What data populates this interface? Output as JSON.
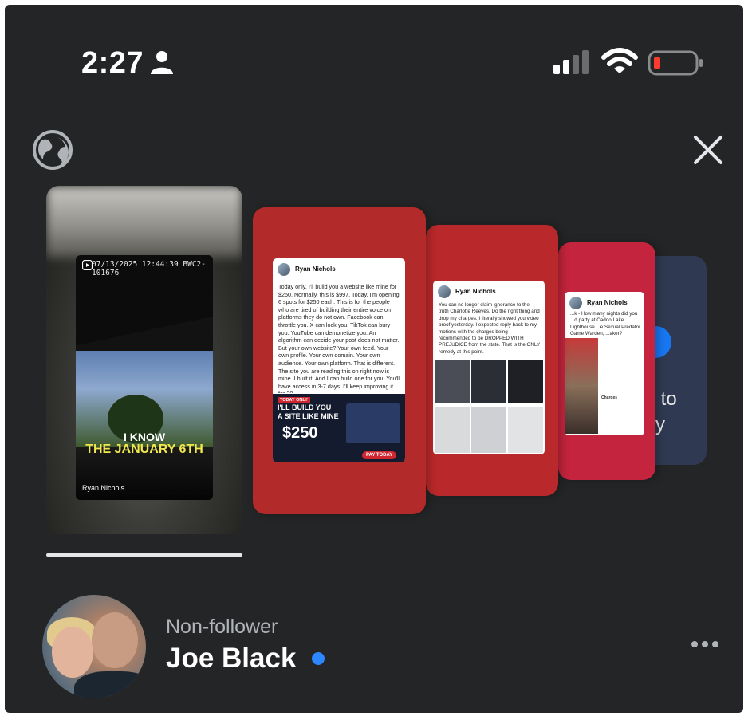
{
  "status_bar": {
    "time": "2:27"
  },
  "cards": [
    {
      "reel": {
        "timestamp": "07/13/2025 12:44:39  BWC2-101676",
        "caption_line1": "I KNOW",
        "caption_line2": "THE JANUARY 6TH",
        "author": "Ryan Nichols"
      }
    },
    {
      "author": "Ryan Nichols",
      "text": "Today only. I'll build you a website like mine for $250. Normally, this is $997. Today, I'm opening 6 spots for $250 each. This is for the people who are tired of building their entire voice on platforms they do not own. Facebook can throttle you. X can lock you. TikTok can bury you. YouTube can demonetize you. An algorithm can decide your post does not matter. But your own website? Your own feed. Your own profile. Your own domain. Your own audience. Your own platform. That is different. The site you are reading this on right now is mine. I built it. And I can build one for you. You'll have access in 3-7 days. I'll keep improving it for 30...",
      "ad": {
        "badge": "TODAY ONLY",
        "line1": "I'LL BUILD YOU",
        "line2": "A SITE LIKE MINE",
        "price": "$250",
        "cta": "PAY TODAY"
      }
    },
    {
      "author": "Ryan Nichols",
      "text": "You can no longer claim ignorance to the truth Charlotte Reeves. Do the right thing and drop my charges. I literally showed you video proof yesterday. I expected reply back to my motions with the charges being recommended to be DROPPED WITH PREJUDICE from the state. That is the ONLY remedy at this point."
    },
    {
      "author": "Ryan Nichols",
      "text": "...k - How many nights did you ...d party at Caddo Lake Lighthouse ...e Sexual Predator Game Warden, ...aker?",
      "list_heading": "Charges"
    },
    {
      "text": "... to\n...y"
    }
  ],
  "profile": {
    "follow_status": "Non-follower",
    "name": "Joe Black",
    "online_color": "#2d88ff"
  },
  "colors": {
    "background": "#242526",
    "accent": "#1877f2",
    "card_red": "#b22a2a"
  }
}
